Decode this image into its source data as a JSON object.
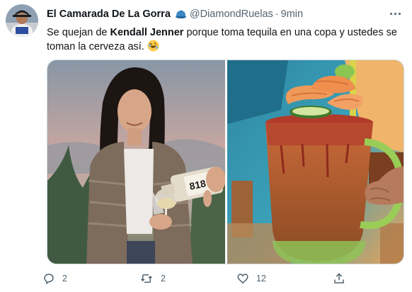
{
  "tweet": {
    "author_name": "El Camarada De La Gorra",
    "author_badge_emoji": "🧢",
    "handle": "@DiamondRuelas",
    "separator": "·",
    "time": "9min",
    "text_part1": "Se quejan de ",
    "text_bold": "Kendall Jenner",
    "text_part2": " porque toma tequila en una copa y ustedes se toman la cerveza así.",
    "text_emoji": "🤣",
    "bottle_label": "818",
    "more_icon": "more-horizontal-icon",
    "colors": {
      "text": "#0f1419",
      "muted": "#536471",
      "border": "#cfd9de"
    }
  },
  "actions": {
    "reply_count": "2",
    "retweet_count": "2",
    "like_count": "12",
    "share_count": ""
  }
}
